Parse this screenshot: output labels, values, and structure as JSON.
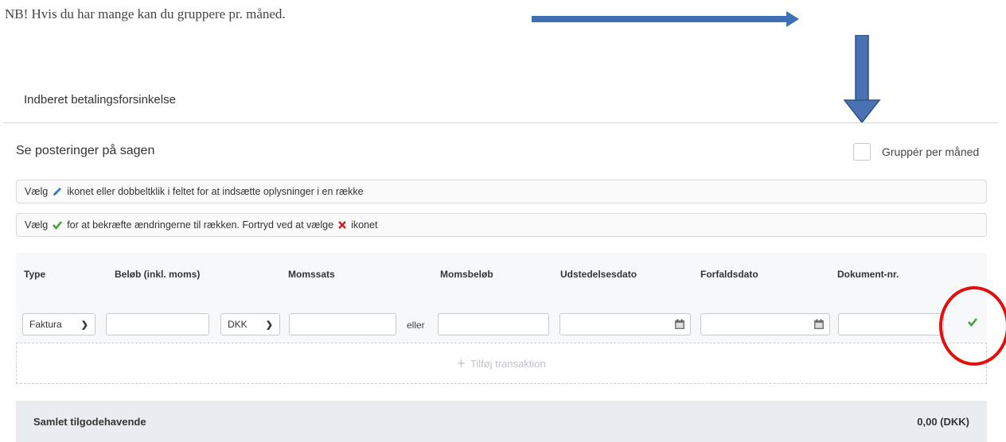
{
  "note": "NB! Hvis du har mange kan du gruppere pr. måned.",
  "panel": {
    "title": "Indberet betalingsforsinkelse"
  },
  "section": {
    "title": "Se posteringer på sagen",
    "group_label": "Gruppér per måned",
    "group_checked": false
  },
  "info": {
    "line1_pre": "Vælg",
    "line1_post": "ikonet eller dobbeltklik i feltet for at indsætte oplysninger i en række",
    "line2_pre": "Vælg",
    "line2_mid": "for at bekræfte ændringerne til rækken. Fortryd ved at vælge",
    "line2_post": "ikonet"
  },
  "table": {
    "headers": [
      "Type",
      "Beløb (inkl. moms)",
      "Momssats",
      "Momsbeløb",
      "Udstedelsesdato",
      "Forfaldsdato",
      "Dokument-nr."
    ],
    "row": {
      "type": "Faktura",
      "currency": "DKK",
      "eller": "eller"
    },
    "add_label": "Tilføj transaktion"
  },
  "total": {
    "label": "Samlet tilgodehavende",
    "value": "0,00  (DKK)"
  },
  "colors": {
    "arrow": "#3e6fb5",
    "check": "#3ca33a",
    "cross": "#d21e1e",
    "circle": "#e01010"
  }
}
